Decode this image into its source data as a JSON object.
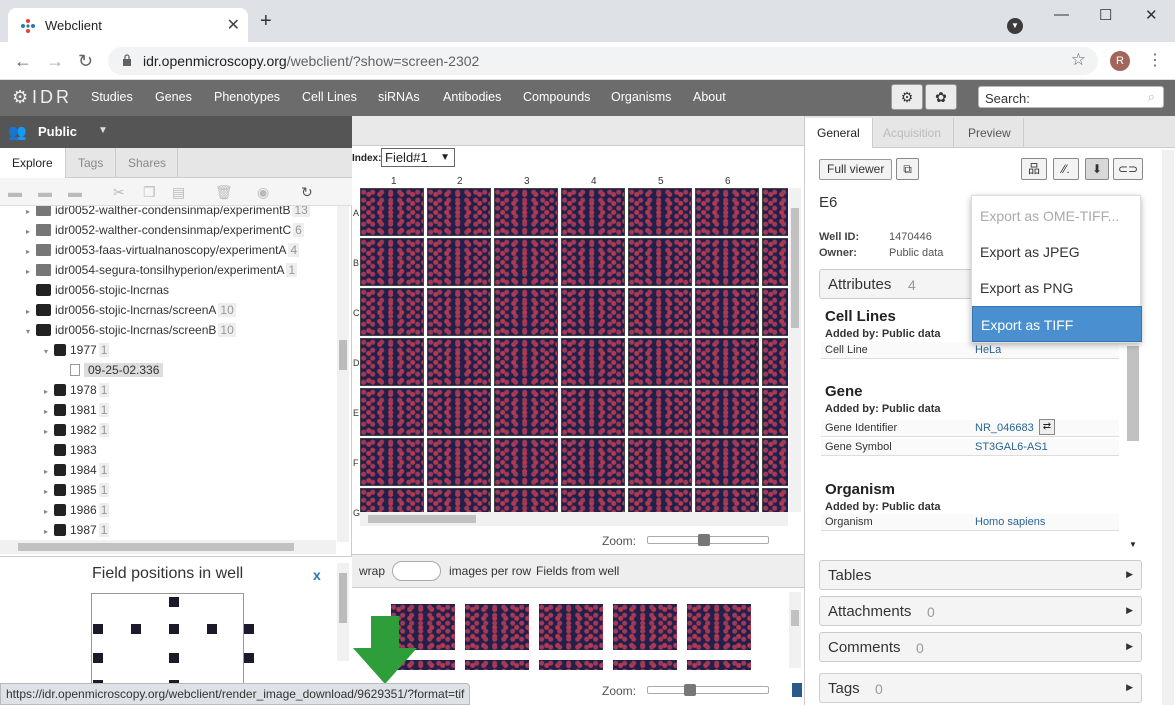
{
  "browser": {
    "tab_title": "Webclient",
    "close_glyph": "✕",
    "newtab_glyph": "+",
    "url_host": "idr.openmicroscopy.org",
    "url_path": "/webclient/?show=screen-2302",
    "avatar_letter": "R",
    "status_url": "https://idr.openmicroscopy.org/webclient/render_image_download/9629351/?format=tif"
  },
  "idr": {
    "logo": "IDR",
    "nav": [
      "Studies",
      "Genes",
      "Phenotypes",
      "Cell Lines",
      "siRNAs",
      "Antibodies",
      "Compounds",
      "Organisms",
      "About"
    ],
    "search_placeholder": "Search:"
  },
  "left": {
    "group": "Public",
    "tabs": [
      "Explore",
      "Tags",
      "Shares"
    ],
    "tree": [
      {
        "label": "idr0052-walther-condensinmap/experimentB",
        "count": "13",
        "type": "folder"
      },
      {
        "label": "idr0052-walther-condensinmap/experimentC",
        "count": "6",
        "type": "folder"
      },
      {
        "label": "idr0053-faas-virtualnanoscopy/experimentA",
        "count": "4",
        "type": "folder"
      },
      {
        "label": "idr0054-segura-tonsilhyperion/experimentA",
        "count": "1",
        "type": "folder"
      },
      {
        "label": "idr0056-stojic-lncrnas",
        "count": "",
        "type": "screen"
      },
      {
        "label": "idr0056-stojic-lncrnas/screenA",
        "count": "10",
        "type": "screen"
      },
      {
        "label": "idr0056-stojic-lncrnas/screenB",
        "count": "10",
        "type": "screen"
      },
      {
        "label": "1977",
        "count": "1",
        "type": "plate"
      },
      {
        "label": "09-25-02.336",
        "count": "",
        "type": "run"
      },
      {
        "label": "1978",
        "count": "1",
        "type": "plate"
      },
      {
        "label": "1981",
        "count": "1",
        "type": "plate"
      },
      {
        "label": "1982",
        "count": "1",
        "type": "plate"
      },
      {
        "label": "1983",
        "count": "",
        "type": "plate"
      },
      {
        "label": "1984",
        "count": "1",
        "type": "plate"
      },
      {
        "label": "1985",
        "count": "1",
        "type": "plate"
      },
      {
        "label": "1986",
        "count": "1",
        "type": "plate"
      },
      {
        "label": "1987",
        "count": "1",
        "type": "plate"
      }
    ],
    "field_panel_title": "Field positions in well",
    "field_panel_close": "x"
  },
  "center": {
    "index_label": "Index:",
    "index_value": "Field#1",
    "columns": [
      "1",
      "2",
      "3",
      "4",
      "5",
      "6"
    ],
    "rows": [
      "A",
      "B",
      "C",
      "D",
      "E",
      "F",
      "G"
    ],
    "zoom_label": "Zoom:",
    "zoom_level_top": 0.45,
    "zoom_level_bottom": 0.33,
    "wrap_label": "wrap",
    "images_per_row": "images per row",
    "fields_from_well": "Fields from well"
  },
  "right": {
    "tabs": [
      "General",
      "Acquisition",
      "Preview"
    ],
    "full_viewer": "Full viewer",
    "well_name": "E6",
    "well_id_label": "Well ID:",
    "well_id": "1470446",
    "owner_label": "Owner:",
    "owner": "Public data",
    "attributes_label": "Attributes",
    "attributes_count": "4",
    "cell_lines_title": "Cell Lines",
    "added_by": "Added by: Public data",
    "cell_line_key": "Cell Line",
    "cell_line_value": "HeLa",
    "gene_title": "Gene",
    "gene_identifier_key": "Gene Identifier",
    "gene_identifier_value": "NR_046683",
    "gene_symbol_key": "Gene Symbol",
    "gene_symbol_value": "ST3GAL6-AS1",
    "organism_title": "Organism",
    "organism_key": "Organism",
    "organism_value": "Homo sapiens",
    "sections": [
      {
        "label": "Tables",
        "count": ""
      },
      {
        "label": "Attachments",
        "count": "0"
      },
      {
        "label": "Comments",
        "count": "0"
      },
      {
        "label": "Tags",
        "count": "0"
      }
    ]
  },
  "export_menu": [
    "Export as OME-TIFF...",
    "Export as JPEG",
    "Export as PNG",
    "Export as TIFF"
  ]
}
